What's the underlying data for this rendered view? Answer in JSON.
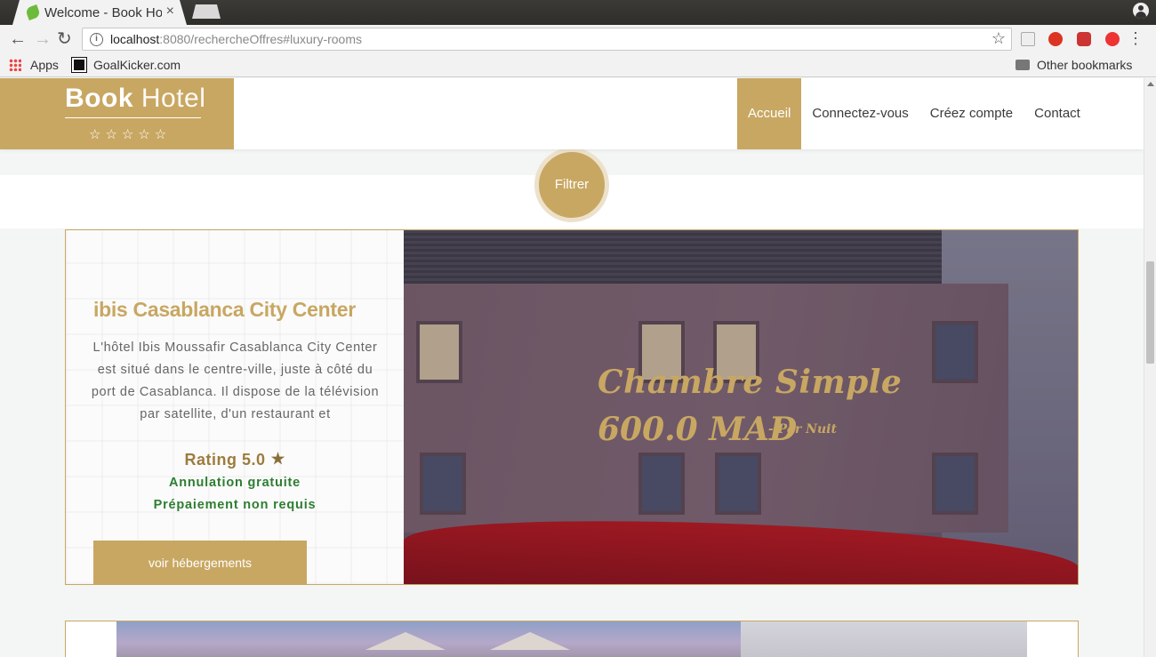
{
  "browser": {
    "tab_title": "Welcome - Book Ho",
    "tab_close": "×",
    "url_host": "localhost",
    "url_rest": ":8080/rechercheOffres#luxury-rooms",
    "back": "←",
    "forward": "→",
    "reload": "↻",
    "bookmark_star": "☆",
    "menu": "⋮",
    "bookmarks": {
      "apps": "Apps",
      "goalkicker": "GoalKicker.com",
      "other": "Other bookmarks"
    },
    "extensions": [
      "reader-icon",
      "opera-icon",
      "adblock-icon",
      "tomato-icon"
    ]
  },
  "site": {
    "logo_bold": "Book",
    "logo_thin": "Hotel",
    "logo_stars": "☆☆☆☆☆",
    "nav": [
      {
        "label": "Accueil",
        "active": true
      },
      {
        "label": "Connectez-vous",
        "active": false
      },
      {
        "label": "Créez compte",
        "active": false
      },
      {
        "label": "Contact",
        "active": false
      }
    ],
    "filter_label": "Filtrer"
  },
  "offer": {
    "hotel_name": "ibis Casablanca City Center",
    "description": "L'hôtel Ibis Moussafir Casablanca City Center est situé dans le centre-ville, juste à côté du port de Casablanca. Il dispose de la télévision par satellite, d'un restaurant et",
    "rating": "Rating 5.0",
    "perk_1": "Annulation gratuite",
    "perk_2": "Prépaiement non requis",
    "cta": "voir hébergements",
    "room_type": "Chambre Simple",
    "price": "600.0 MAD",
    "price_suffix": "- Par Nuit"
  },
  "colors": {
    "gold": "#c8a762",
    "green": "#2e7d32"
  }
}
